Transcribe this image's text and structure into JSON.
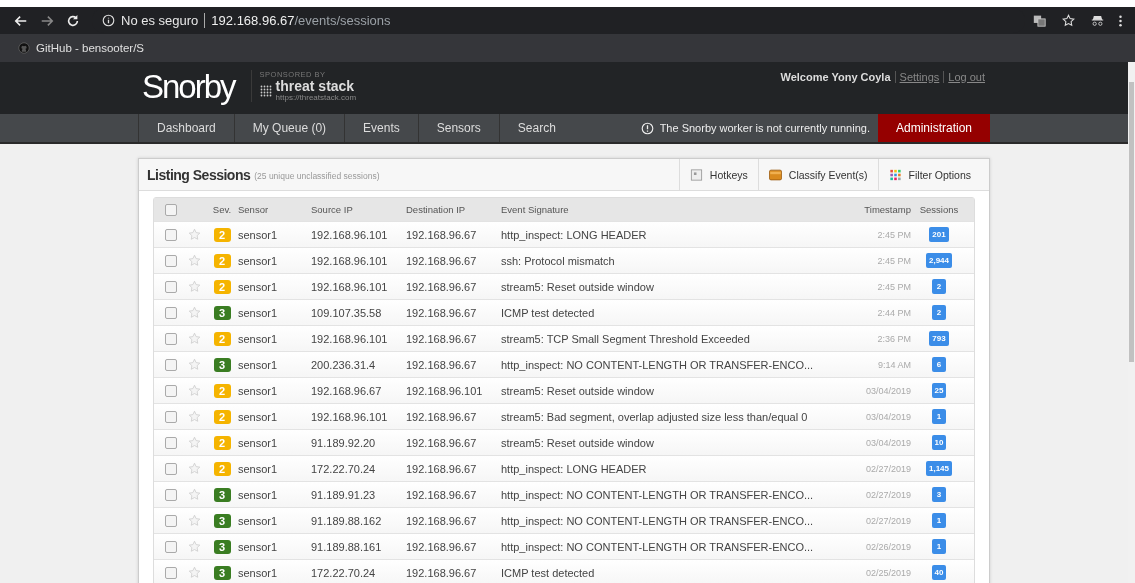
{
  "browser": {
    "security": "No es seguro",
    "url_host": "192.168.96.67",
    "url_path": "/events/sessions",
    "bookmark": "GitHub - bensooter/S"
  },
  "header": {
    "logo": "Snorby",
    "sponsor_label": "SPONSORED BY",
    "sponsor_name": "threat stack",
    "sponsor_url": "https://threatstack.com",
    "welcome": "Welcome Yony Coyla",
    "links": [
      "Settings",
      "Log out"
    ]
  },
  "nav": {
    "items": [
      {
        "label": "Dashboard",
        "selected": false
      },
      {
        "label": "My Queue (0)",
        "selected": false
      },
      {
        "label": "Events",
        "selected": false
      },
      {
        "label": "Sensors",
        "selected": false
      },
      {
        "label": "Search",
        "selected": false
      }
    ],
    "warning": "The Snorby worker is not currently running.",
    "admin": "Administration"
  },
  "panel": {
    "title": "Listing Sessions",
    "subtitle": "(25 unique unclassified sessions)",
    "actions": [
      {
        "label": "Hotkeys",
        "kind": "hotkeys"
      },
      {
        "label": "Classify Event(s)",
        "kind": "classify"
      },
      {
        "label": "Filter Options",
        "kind": "filter"
      }
    ]
  },
  "table": {
    "columns": [
      "Sev.",
      "Sensor",
      "Source IP",
      "Destination IP",
      "Event Signature",
      "Timestamp",
      "Sessions"
    ],
    "select_all": {
      "checked": false
    },
    "rows": [
      {
        "checked": false,
        "starred": false,
        "sev": "2",
        "color": "#f5b400",
        "sensor": "sensor1",
        "src": "192.168.96.101",
        "dst": "192.168.96.67",
        "signature": "http_inspect: LONG HEADER",
        "time": "2:45 PM",
        "sessions": "201"
      },
      {
        "checked": false,
        "starred": false,
        "sev": "2",
        "color": "#f5b400",
        "sensor": "sensor1",
        "src": "192.168.96.101",
        "dst": "192.168.96.67",
        "signature": "ssh: Protocol mismatch",
        "time": "2:45 PM",
        "sessions": "2,944"
      },
      {
        "checked": false,
        "starred": false,
        "sev": "2",
        "color": "#f5b400",
        "sensor": "sensor1",
        "src": "192.168.96.101",
        "dst": "192.168.96.67",
        "signature": "stream5: Reset outside window",
        "time": "2:45 PM",
        "sessions": "2"
      },
      {
        "checked": false,
        "starred": false,
        "sev": "3",
        "color": "#3a7d22",
        "sensor": "sensor1",
        "src": "109.107.35.58",
        "dst": "192.168.96.67",
        "signature": "ICMP test detected",
        "time": "2:44 PM",
        "sessions": "2"
      },
      {
        "checked": false,
        "starred": false,
        "sev": "2",
        "color": "#f5b400",
        "sensor": "sensor1",
        "src": "192.168.96.101",
        "dst": "192.168.96.67",
        "signature": "stream5: TCP Small Segment Threshold Exceeded",
        "time": "2:36 PM",
        "sessions": "793"
      },
      {
        "checked": false,
        "starred": false,
        "sev": "3",
        "color": "#3a7d22",
        "sensor": "sensor1",
        "src": "200.236.31.4",
        "dst": "192.168.96.67",
        "signature": "http_inspect: NO CONTENT-LENGTH OR TRANSFER-ENCO...",
        "time": "9:14 AM",
        "sessions": "6"
      },
      {
        "checked": false,
        "starred": false,
        "sev": "2",
        "color": "#f5b400",
        "sensor": "sensor1",
        "src": "192.168.96.67",
        "dst": "192.168.96.101",
        "signature": "stream5: Reset outside window",
        "time": "03/04/2019",
        "sessions": "25"
      },
      {
        "checked": false,
        "starred": false,
        "sev": "2",
        "color": "#f5b400",
        "sensor": "sensor1",
        "src": "192.168.96.101",
        "dst": "192.168.96.67",
        "signature": "stream5: Bad segment, overlap adjusted size less than/equal 0",
        "time": "03/04/2019",
        "sessions": "1"
      },
      {
        "checked": false,
        "starred": false,
        "sev": "2",
        "color": "#f5b400",
        "sensor": "sensor1",
        "src": "91.189.92.20",
        "dst": "192.168.96.67",
        "signature": "stream5: Reset outside window",
        "time": "03/04/2019",
        "sessions": "10"
      },
      {
        "checked": false,
        "starred": false,
        "sev": "2",
        "color": "#f5b400",
        "sensor": "sensor1",
        "src": "172.22.70.24",
        "dst": "192.168.96.67",
        "signature": "http_inspect: LONG HEADER",
        "time": "02/27/2019",
        "sessions": "1,145"
      },
      {
        "checked": false,
        "starred": false,
        "sev": "3",
        "color": "#3a7d22",
        "sensor": "sensor1",
        "src": "91.189.91.23",
        "dst": "192.168.96.67",
        "signature": "http_inspect: NO CONTENT-LENGTH OR TRANSFER-ENCO...",
        "time": "02/27/2019",
        "sessions": "3"
      },
      {
        "checked": false,
        "starred": false,
        "sev": "3",
        "color": "#3a7d22",
        "sensor": "sensor1",
        "src": "91.189.88.162",
        "dst": "192.168.96.67",
        "signature": "http_inspect: NO CONTENT-LENGTH OR TRANSFER-ENCO...",
        "time": "02/27/2019",
        "sessions": "1"
      },
      {
        "checked": false,
        "starred": false,
        "sev": "3",
        "color": "#3a7d22",
        "sensor": "sensor1",
        "src": "91.189.88.161",
        "dst": "192.168.96.67",
        "signature": "http_inspect: NO CONTENT-LENGTH OR TRANSFER-ENCO...",
        "time": "02/26/2019",
        "sessions": "1"
      },
      {
        "checked": false,
        "starred": false,
        "sev": "3",
        "color": "#3a7d22",
        "sensor": "sensor1",
        "src": "172.22.70.24",
        "dst": "192.168.96.67",
        "signature": "ICMP test detected",
        "time": "02/25/2019",
        "sessions": "40"
      }
    ]
  }
}
